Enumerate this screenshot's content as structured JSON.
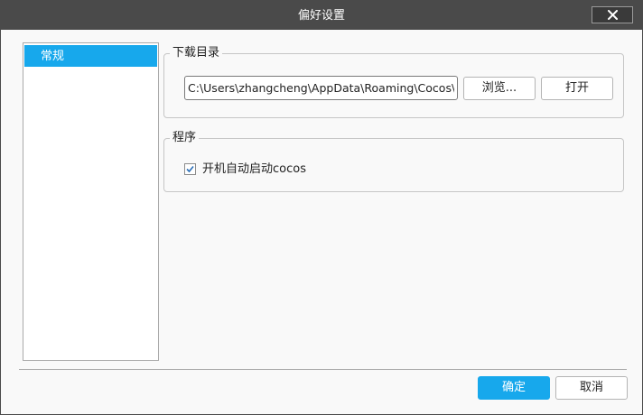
{
  "window": {
    "title": "偏好设置"
  },
  "titlebar": {
    "close_icon": "close-icon"
  },
  "sidebar": {
    "items": [
      {
        "label": "常规",
        "selected": true
      }
    ]
  },
  "download_group": {
    "legend": "下载目录",
    "path_value": "C:\\Users\\zhangcheng\\AppData\\Roaming\\Cocos\\",
    "browse_label": "浏览...",
    "open_label": "打开"
  },
  "program_group": {
    "legend": "程序",
    "autostart_label": "开机自动启动cocos",
    "autostart_checked": true
  },
  "footer": {
    "ok_label": "确定",
    "cancel_label": "取消"
  },
  "colors": {
    "titlebar": "#4a4a4a",
    "accent": "#17a8ec",
    "background": "#f9f9f9"
  }
}
